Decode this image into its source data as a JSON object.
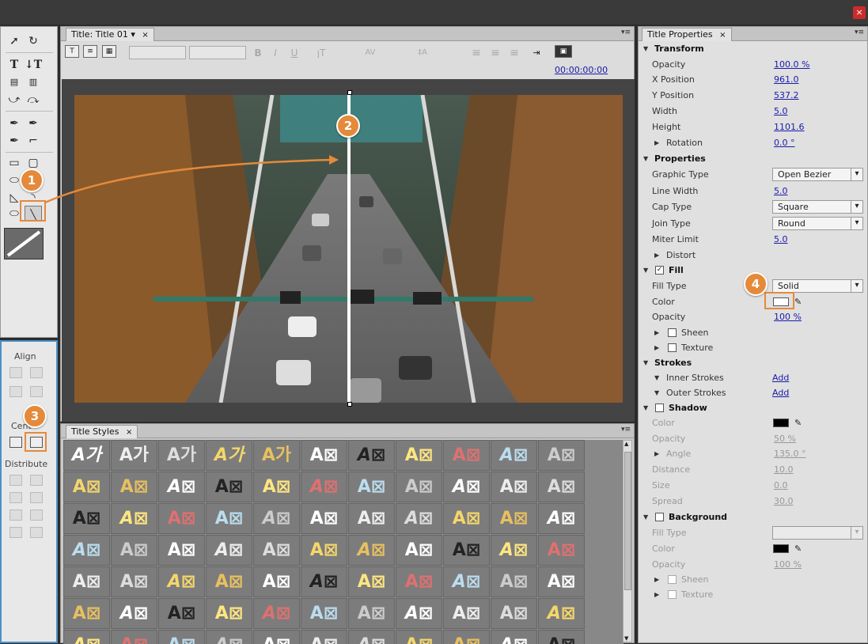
{
  "window": {
    "close_label": "×"
  },
  "title_panel": {
    "tab": "Title: Title 01",
    "timecode": "00:00:00:00"
  },
  "styles_panel": {
    "tab": "Title Styles",
    "sample_text": "A⊠",
    "sample_text_kr": "A가"
  },
  "align_panel": {
    "align_label": "Align",
    "center_label": "Cent",
    "distribute_label": "Distribute"
  },
  "properties_panel": {
    "tab": "Title Properties",
    "transform": {
      "header": "Transform",
      "opacity_label": "Opacity",
      "opacity_value": "100.0 %",
      "x_label": "X Position",
      "x_value": "961.0",
      "y_label": "Y Position",
      "y_value": "537.2",
      "width_label": "Width",
      "width_value": "5.0",
      "height_label": "Height",
      "height_value": "1101.6",
      "rotation_label": "Rotation",
      "rotation_value": "0.0 °"
    },
    "properties": {
      "header": "Properties",
      "graphic_type_label": "Graphic Type",
      "graphic_type_value": "Open Bezier",
      "line_width_label": "Line Width",
      "line_width_value": "5.0",
      "cap_type_label": "Cap Type",
      "cap_type_value": "Square",
      "join_type_label": "Join Type",
      "join_type_value": "Round",
      "miter_label": "Miter Limit",
      "miter_value": "5.0",
      "distort_label": "Distort"
    },
    "fill": {
      "header": "Fill",
      "fill_type_label": "Fill Type",
      "fill_type_value": "Solid",
      "color_label": "Color",
      "opacity_label": "Opacity",
      "opacity_value": "100 %",
      "sheen_label": "Sheen",
      "texture_label": "Texture"
    },
    "strokes": {
      "header": "Strokes",
      "inner_label": "Inner Strokes",
      "inner_add": "Add",
      "outer_label": "Outer Strokes",
      "outer_add": "Add"
    },
    "shadow": {
      "header": "Shadow",
      "color_label": "Color",
      "opacity_label": "Opacity",
      "opacity_value": "50 %",
      "angle_label": "Angle",
      "angle_value": "135.0 °",
      "distance_label": "Distance",
      "distance_value": "10.0",
      "size_label": "Size",
      "size_value": "0.0",
      "spread_label": "Spread",
      "spread_value": "30.0"
    },
    "background": {
      "header": "Background",
      "fill_type_label": "Fill Type",
      "color_label": "Color",
      "opacity_label": "Opacity",
      "opacity_value": "100 %",
      "sheen_label": "Sheen",
      "texture_label": "Texture"
    }
  },
  "callouts": {
    "one": "1",
    "two": "2",
    "three": "3",
    "four": "4"
  },
  "colors": {
    "accent": "#e58a3a",
    "link": "#1a1aaa",
    "panel_border": "#4a90c8"
  }
}
